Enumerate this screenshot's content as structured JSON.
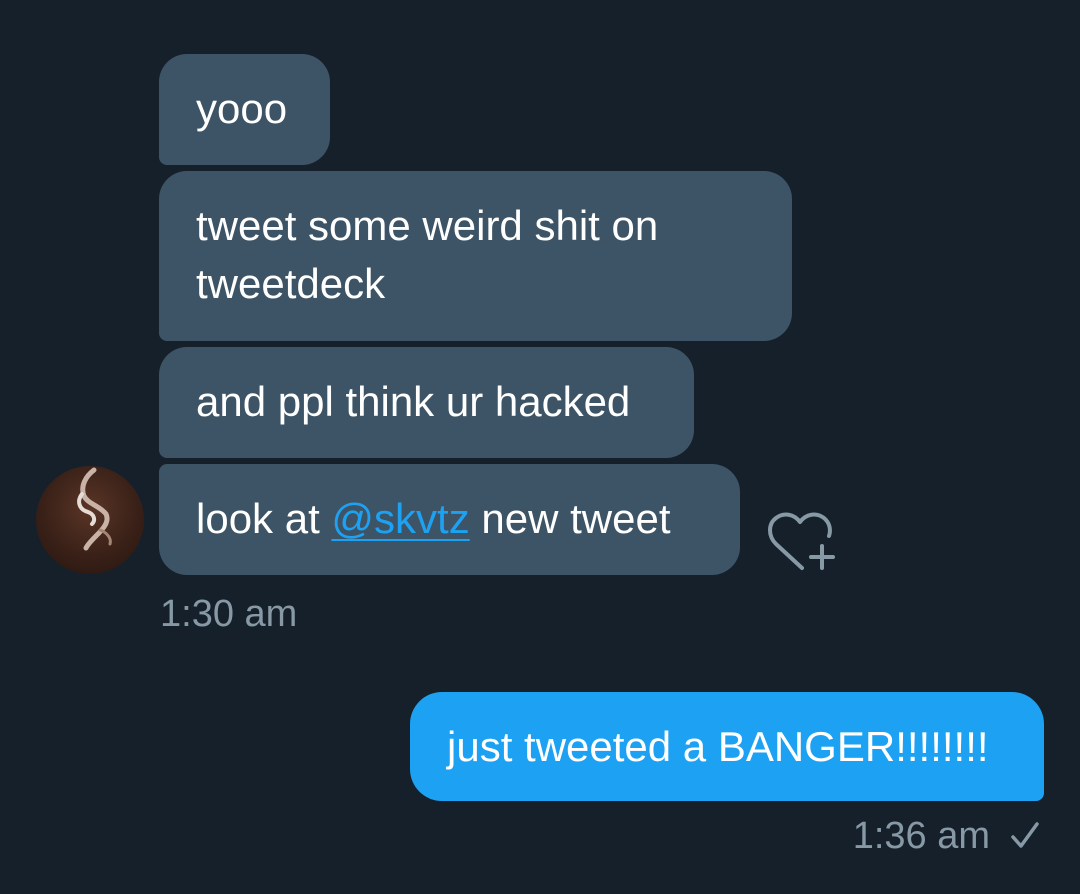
{
  "conversation": {
    "received_messages": [
      {
        "text": "yooo"
      },
      {
        "text": "tweet some weird shit on tweetdeck"
      },
      {
        "text": "and ppl think ur hacked"
      },
      {
        "prefix": "look at ",
        "mention": "@skvtz",
        "suffix": " new tweet"
      }
    ],
    "received_time": "1:30 am",
    "sent_messages": [
      {
        "text": "just tweeted a BANGER!!!!!!!!"
      }
    ],
    "sent_time": "1:36 am",
    "sent_status_icon": "checkmark-icon",
    "reaction_icon": "heart-plus-icon"
  },
  "colors": {
    "background": "#15202b",
    "received_bubble": "#3d5466",
    "sent_bubble": "#1da1f2",
    "mention": "#1da1f2",
    "timestamp": "#8899a6"
  }
}
